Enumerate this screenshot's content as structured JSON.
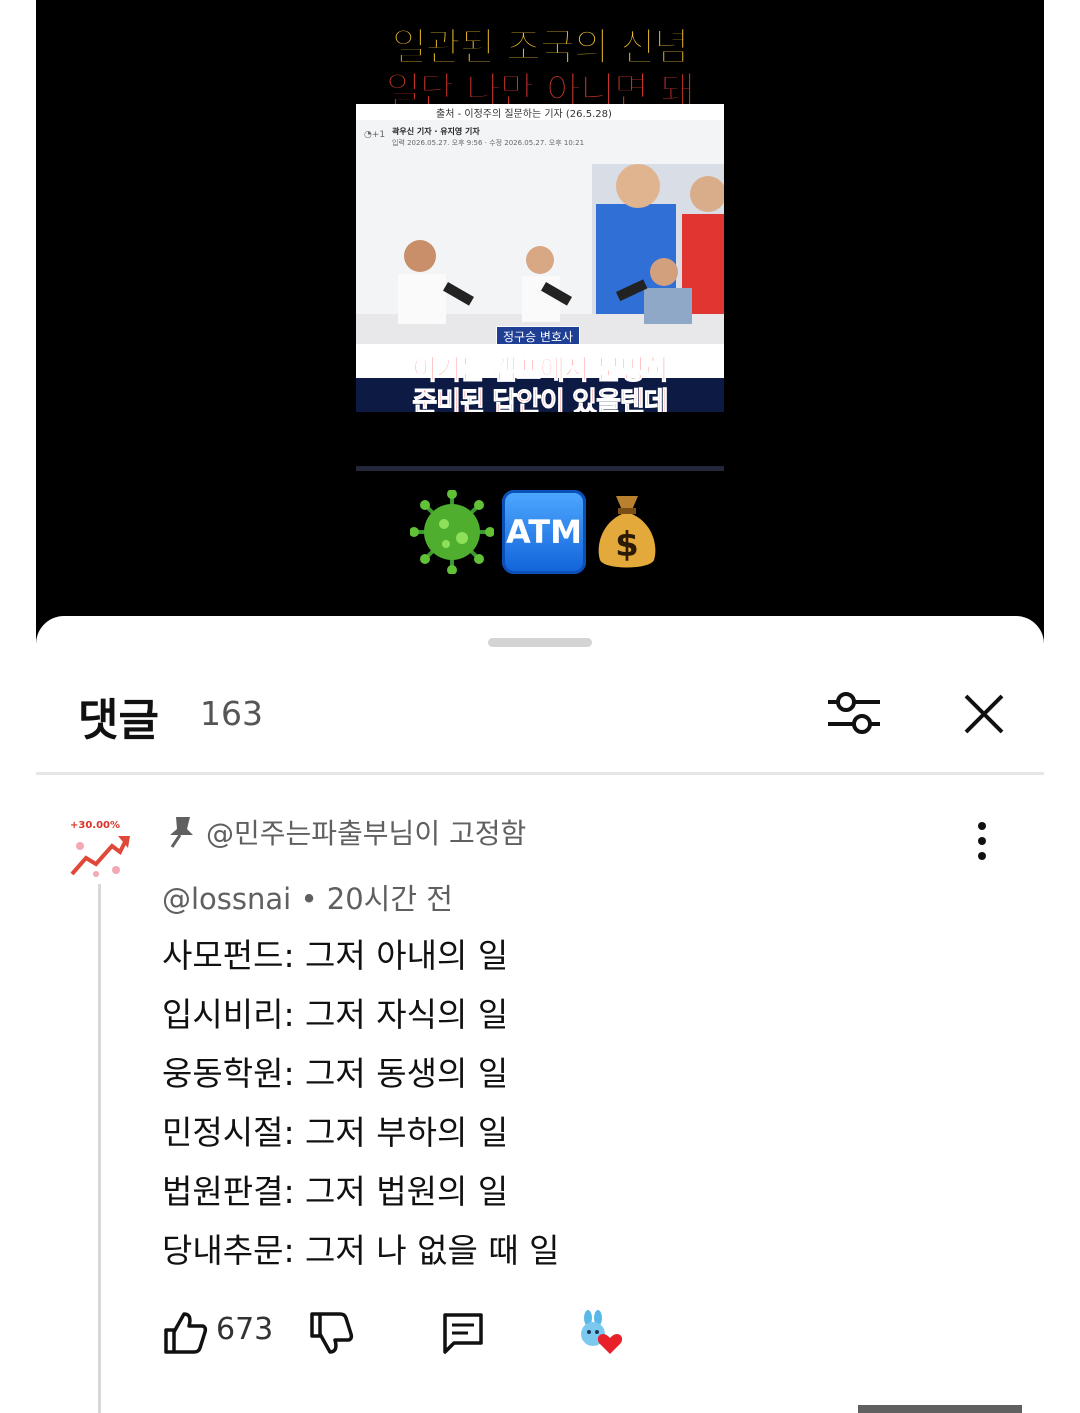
{
  "video": {
    "title_line1": "일관된 조국의 신념",
    "title_line2": "일단 나만 아니면 돼",
    "thumbnail": {
      "source": "출처 - 이정주의 질문하는 기자 (26.5.28)",
      "meta_reporters": "곽우신 기자 · 유지영 기자",
      "meta_dates": "입력 2026.05.27. 오후 9:56 · 수정 2026.05.27. 오후 10:21",
      "name_tag": "정구승 변호사",
      "subtitle_line1": "이거는 캠프에서 분명히",
      "subtitle_line2": "준비된 답안이 있을텐데"
    },
    "emoji_atm_label": "ATM"
  },
  "comments_panel": {
    "title": "댓글",
    "count": "163",
    "pinned_label": "@민주는파출부님이 고정함",
    "comment": {
      "author": "@lossnai",
      "time": "20시간 전",
      "lines": [
        "사모펀드: 그저 아내의 일",
        "입시비리: 그저 자식의 일",
        "웅동학원: 그저 동생의 일",
        "민정시절: 그저 부하의 일",
        "법원판결: 그저 법원의 일",
        "당내추문: 그저 나 없을 때 일"
      ],
      "likes": "673"
    }
  },
  "colors": {
    "title_yellow": "#f2c230",
    "title_red": "#e23b2f",
    "atm_blue": "#1162d9",
    "heart_red": "#e8202a"
  },
  "icons": [
    "pin-icon",
    "filter-icon",
    "close-icon",
    "more-vert-icon",
    "like-icon",
    "dislike-icon",
    "reply-icon",
    "creator-heart-icon",
    "virus-emoji",
    "money-bag-emoji"
  ]
}
